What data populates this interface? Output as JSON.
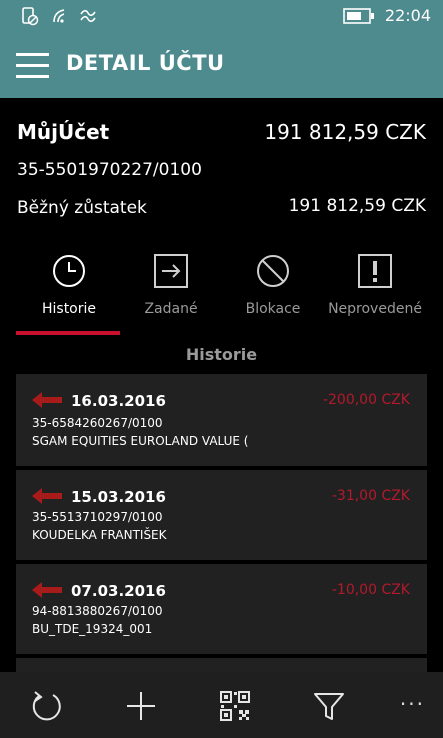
{
  "status_bar": {
    "time": "22:04",
    "icons": [
      "rotation-lock-icon",
      "wifi-icon",
      "network-icon",
      "battery-icon"
    ]
  },
  "header": {
    "title": "DETAIL ÚČTU",
    "menu_icon": "hamburger-menu-icon"
  },
  "account": {
    "name": "MůjÚčet",
    "balance": "191 812,59 CZK",
    "number": "35-5501970227/0100",
    "current_label": "Běžný zůstatek",
    "current_value": "191 812,59 CZK"
  },
  "tabs": [
    {
      "label": "Historie",
      "icon": "clock-icon",
      "active": true
    },
    {
      "label": "Zadané",
      "icon": "outgoing-arrow-icon",
      "active": false
    },
    {
      "label": "Blokace",
      "icon": "blocked-icon",
      "active": false
    },
    {
      "label": "Neprovedené",
      "icon": "exclamation-icon",
      "active": false
    }
  ],
  "section_title": "Historie",
  "transactions": [
    {
      "date": "16.03.2016",
      "amount": "-200,00 CZK",
      "account": "35-6584260267/0100",
      "description": "SGAM EQUITIES EUROLAND VALUE ("
    },
    {
      "date": "15.03.2016",
      "amount": "-31,00 CZK",
      "account": "35-5513710297/0100",
      "description": "KOUDELKA FRANTIŠEK"
    },
    {
      "date": "07.03.2016",
      "amount": "-10,00 CZK",
      "account": "94-8813880267/0100",
      "description": "BU_TDE_19324_001"
    }
  ],
  "app_bar": {
    "buttons": [
      "refresh-icon",
      "add-icon",
      "qr-code-icon",
      "filter-icon"
    ],
    "more": "···"
  },
  "colors": {
    "header_bg": "#4e8b8e",
    "accent_red": "#c8102e",
    "negative_amount": "#b21a2c",
    "card_bg": "#212121"
  }
}
